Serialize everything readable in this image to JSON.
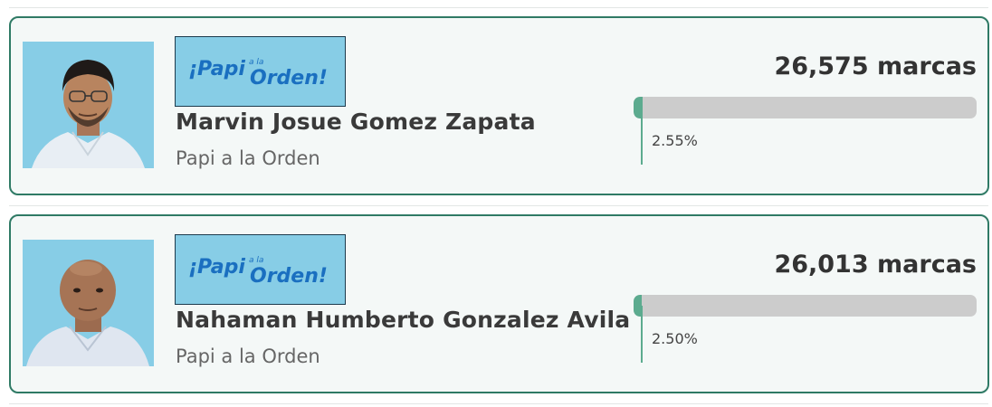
{
  "candidates": [
    {
      "name": "Marvin Josue Gomez Zapata",
      "party": "Papi a la Orden",
      "party_logo_text": "¡Papi a la Orden!",
      "votes_text": "26,575 marcas",
      "percent_text": "2.55%",
      "percent_value": 2.55
    },
    {
      "name": "Nahaman Humberto Gonzalez Avila",
      "party": "Papi a la Orden",
      "party_logo_text": "¡Papi a la Orden!",
      "votes_text": "26,013 marcas",
      "percent_text": "2.50%",
      "percent_value": 2.5
    }
  ],
  "colors": {
    "card_border": "#2f7a65",
    "card_background": "#f4f8f7",
    "bar_fill": "#5cab8f",
    "bar_track": "#cccccc",
    "photo_background": "#87cde6",
    "logo_text": "#1a6fc0"
  },
  "icons": {
    "photo": "candidate-photo",
    "logo": "party-logo"
  }
}
